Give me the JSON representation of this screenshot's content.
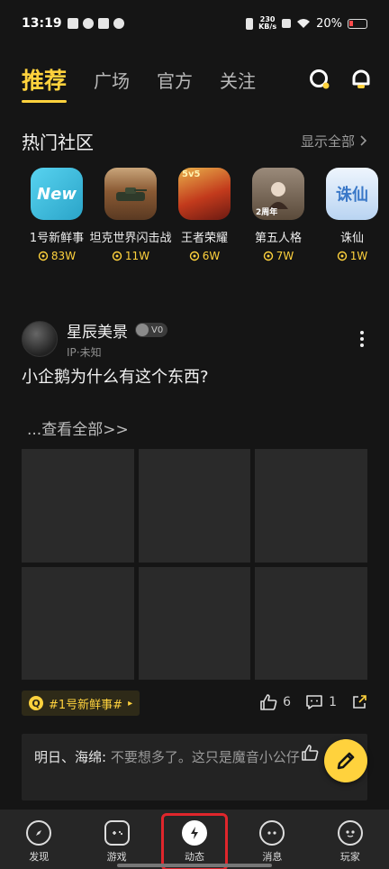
{
  "status_bar": {
    "time": "13:19",
    "net_speed_value": "230",
    "net_speed_unit": "KB/s",
    "battery": "20%"
  },
  "top_nav": {
    "tabs": [
      {
        "label": "推荐",
        "active": true
      },
      {
        "label": "广场",
        "active": false
      },
      {
        "label": "官方",
        "active": false
      },
      {
        "label": "关注",
        "active": false
      }
    ],
    "icons": [
      "search-icon",
      "bell-icon"
    ]
  },
  "hot_communities": {
    "title": "热门社区",
    "show_all": "显示全部",
    "items": [
      {
        "name": "1号新鲜事",
        "count": "83W",
        "icon_text": "New",
        "color": "#37c3e4"
      },
      {
        "name": "坦克世界闪击战",
        "count": "11W",
        "icon_text": "",
        "color": "#7a4a2a"
      },
      {
        "name": "王者荣耀",
        "count": "6W",
        "icon_text": "5v5",
        "color": "#c23a1c"
      },
      {
        "name": "第五人格",
        "count": "7W",
        "icon_text": "2周年",
        "color": "#6b5a4a"
      },
      {
        "name": "诛仙",
        "count": "1W",
        "icon_text": "诛仙",
        "color": "#cfe2f7"
      }
    ]
  },
  "post": {
    "author": "星辰美景",
    "badge": "V0",
    "ip": "IP·未知",
    "text": "小企鹅为什么有这个东西?",
    "see_all": "...查看全部>>",
    "tag": "#1号新鲜事#",
    "tag_arrow": "▸",
    "likes": "6",
    "comments": "1"
  },
  "comment": {
    "author": "明日、海绵:",
    "text": "不要想多了。这只是魔音小公仔"
  },
  "bottom_nav": [
    {
      "label": "发现",
      "icon": "compass-icon",
      "active": false
    },
    {
      "label": "游戏",
      "icon": "gamepad-icon",
      "active": false
    },
    {
      "label": "动态",
      "icon": "lightning-icon",
      "active": true
    },
    {
      "label": "消息",
      "icon": "chat-icon",
      "active": false
    },
    {
      "label": "玩家",
      "icon": "player-icon",
      "active": false
    }
  ],
  "colors": {
    "accent": "#ffd23d",
    "background": "#151515",
    "highlight_border": "#e0262c"
  }
}
